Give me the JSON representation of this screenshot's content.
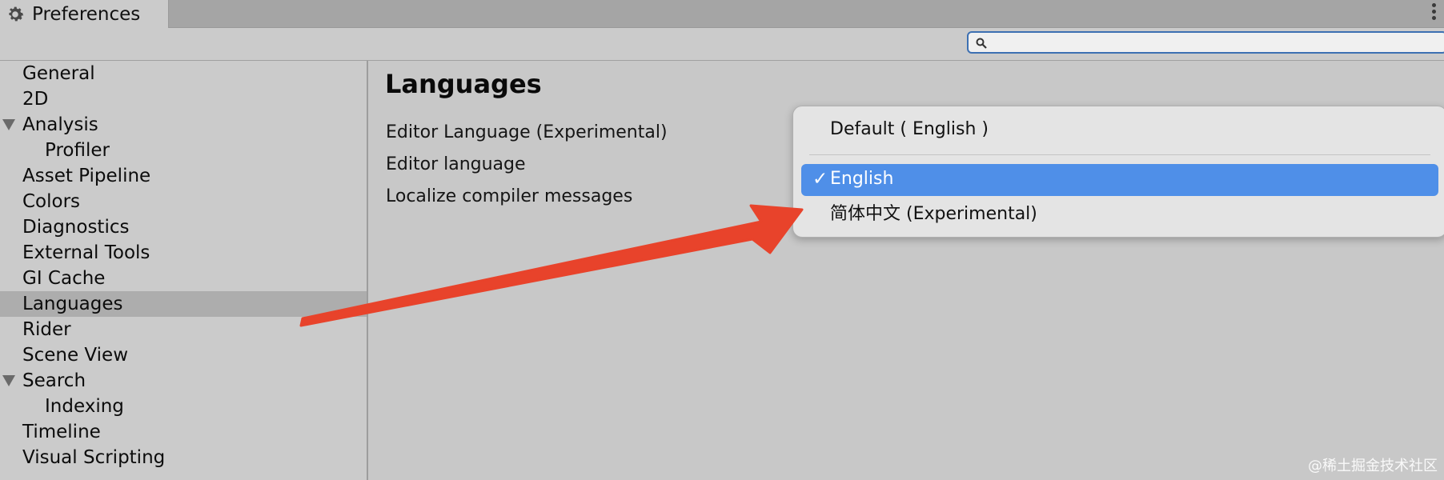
{
  "window": {
    "tab_title": "Preferences"
  },
  "search": {
    "value": "",
    "placeholder": ""
  },
  "sidebar": {
    "items": [
      {
        "label": "General"
      },
      {
        "label": "2D"
      },
      {
        "label": "Analysis",
        "expanded": true
      },
      {
        "label": "Profiler",
        "child": true
      },
      {
        "label": "Asset Pipeline"
      },
      {
        "label": "Colors"
      },
      {
        "label": "Diagnostics"
      },
      {
        "label": "External Tools"
      },
      {
        "label": "GI Cache"
      },
      {
        "label": "Languages",
        "selected": true
      },
      {
        "label": "Rider"
      },
      {
        "label": "Scene View"
      },
      {
        "label": "Search",
        "expanded": true
      },
      {
        "label": "Indexing",
        "child": true
      },
      {
        "label": "Timeline"
      },
      {
        "label": "Visual Scripting"
      }
    ]
  },
  "main": {
    "heading": "Languages",
    "rows": [
      {
        "label": "Editor Language (Experimental)"
      },
      {
        "label": "Editor language"
      },
      {
        "label": "Localize compiler messages"
      }
    ]
  },
  "dropdown": {
    "options": [
      {
        "label": "Default ( English )"
      },
      {
        "label": "English",
        "selected": true,
        "check": "✓"
      },
      {
        "label": "简体中文 (Experimental)"
      }
    ]
  },
  "watermark": "@稀土掘金技术社区",
  "colors": {
    "background": "#c8c8c8",
    "sidebar_selected": "#adadad",
    "menu_highlight": "#4f8fe8",
    "arrow": "#e8432b",
    "search_border": "#3d70b2"
  },
  "icons": {
    "tab": "gear-icon",
    "menu": "kebab-menu-icon",
    "search": "magnifier-icon",
    "annotation": "red-arrow"
  }
}
